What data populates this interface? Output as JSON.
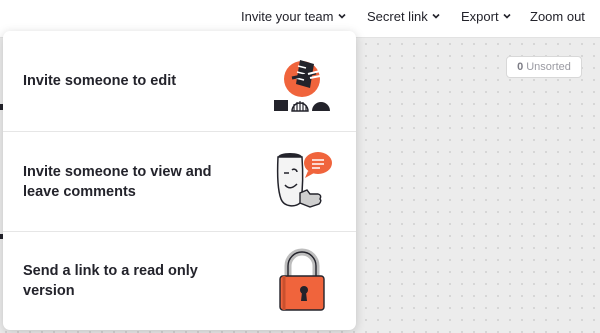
{
  "topbar": {
    "invite_label": "Invite your team",
    "secret_link_label": "Secret link",
    "export_label": "Export",
    "zoom_label": "Zoom out"
  },
  "canvas": {
    "unsorted_count": "0",
    "unsorted_label": "Unsorted"
  },
  "dropdown": {
    "items": [
      {
        "label": "Invite someone to edit",
        "icon": "edit-collaborator-illustration"
      },
      {
        "label": "Invite someone to view and leave comments",
        "icon": "comment-illustration"
      },
      {
        "label": "Send a link to a read only version",
        "icon": "padlock-illustration"
      }
    ]
  },
  "colors": {
    "accent_orange": "#f0643c",
    "ink": "#23232b",
    "canvas_bg": "#ececec"
  }
}
